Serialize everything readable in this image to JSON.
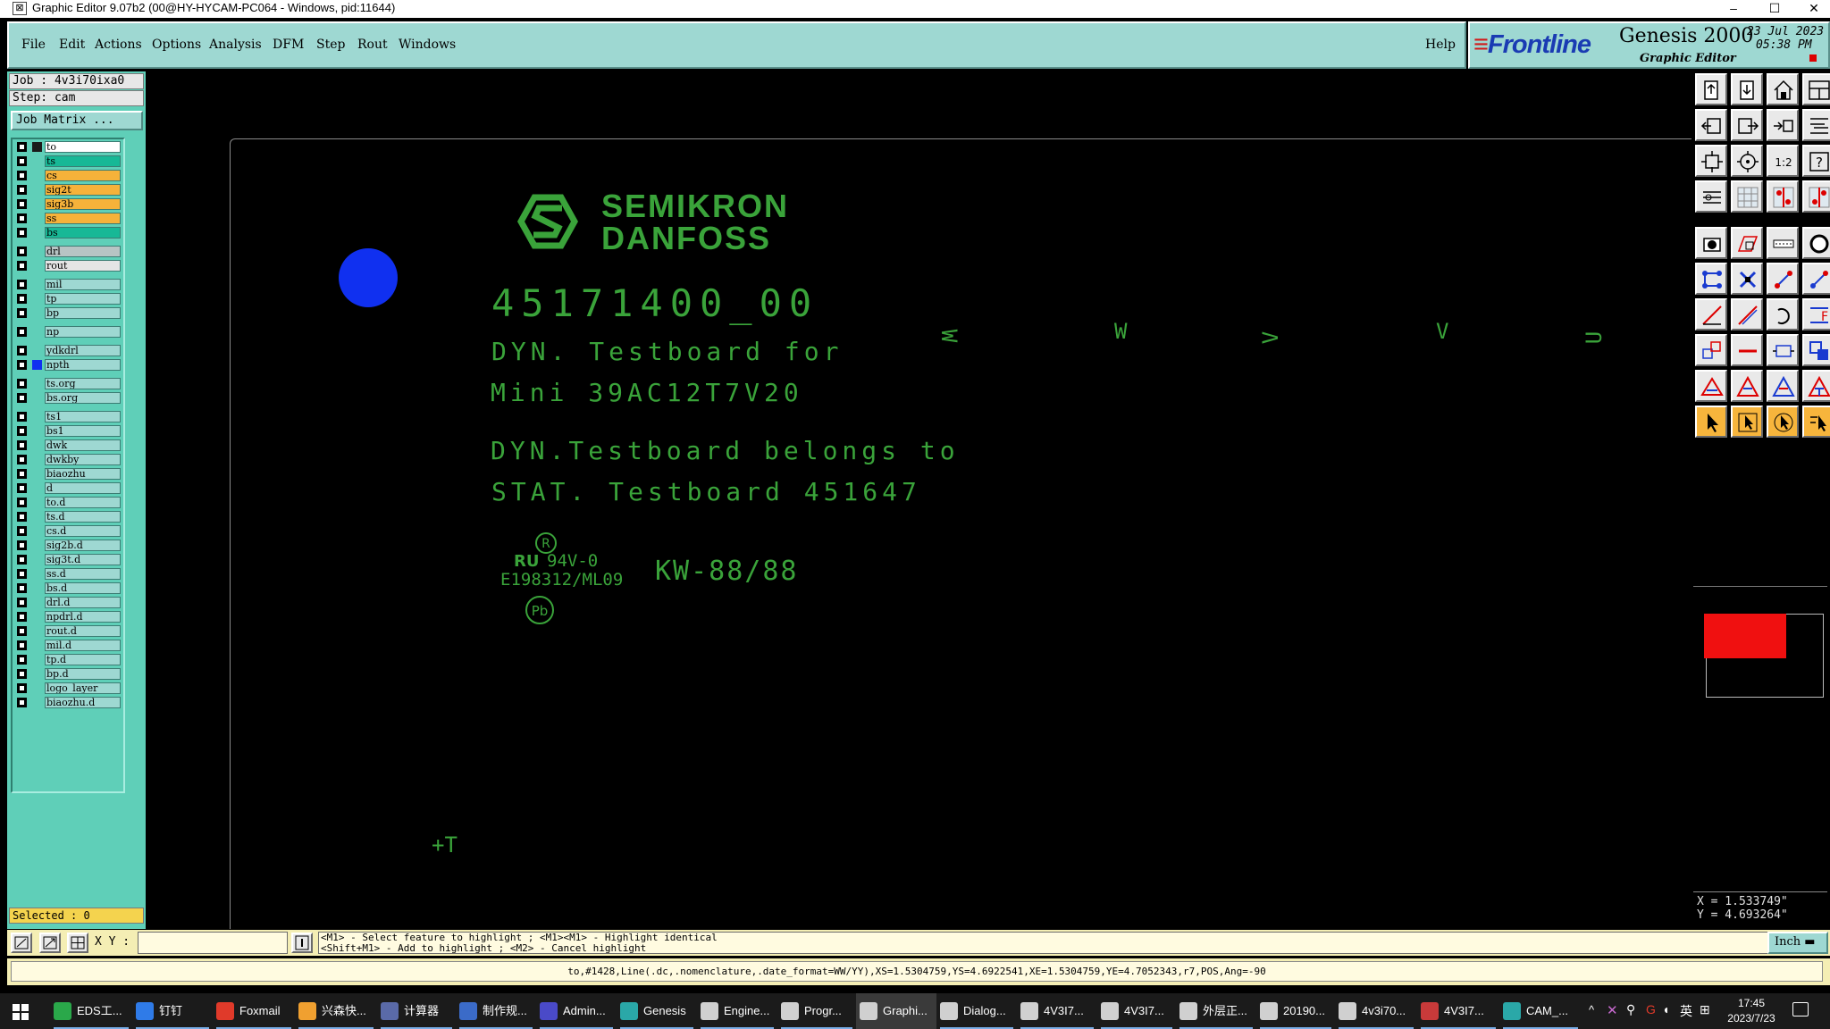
{
  "window": {
    "title": "Graphic Editor 9.07b2 (00@HY-HYCAM-PC064 - Windows, pid:11644)",
    "controls": [
      "–",
      "☐",
      "✕"
    ]
  },
  "menubar": {
    "items": [
      "File",
      "Edit",
      "Actions",
      "Options",
      "Analysis",
      "DFM",
      "Step",
      "Rout",
      "Windows"
    ],
    "help": "Help"
  },
  "brand": {
    "logo": "Frontline",
    "product": "Genesis 2000",
    "subtitle": "Graphic Editor",
    "date": "23 Jul 2023",
    "time": "05:38 PM"
  },
  "job": {
    "job_label": "Job : 4v3i70ixa0",
    "step_label": "Step: cam",
    "matrix_button": "Job Matrix ..."
  },
  "layers": [
    {
      "name": "to",
      "color": "#ffffff",
      "swatch": "#1a1a1a",
      "gap_before": false
    },
    {
      "name": "ts",
      "color": "#17b896",
      "swatch": "#5fcfb8",
      "gap_before": false
    },
    {
      "name": "cs",
      "color": "#f6b23a",
      "swatch": "#5fcfb8",
      "gap_before": false
    },
    {
      "name": "sig2t",
      "color": "#f6b23a",
      "swatch": "#5fcfb8",
      "gap_before": false
    },
    {
      "name": "sig3b",
      "color": "#f6b23a",
      "swatch": "#5fcfb8",
      "gap_before": false
    },
    {
      "name": "ss",
      "color": "#f6b23a",
      "swatch": "#5fcfb8",
      "gap_before": false
    },
    {
      "name": "bs",
      "color": "#17b896",
      "swatch": "#5fcfb8",
      "gap_before": false
    },
    {
      "name": "drl",
      "color": "#b7c4c4",
      "swatch": "#5fcfb8",
      "gap_before": true
    },
    {
      "name": "rout",
      "color": "#e5e5e5",
      "swatch": "#5fcfb8",
      "gap_before": false
    },
    {
      "name": "mil",
      "color": "#9ed8d2",
      "swatch": "#5fcfb8",
      "gap_before": true
    },
    {
      "name": "tp",
      "color": "#9ed8d2",
      "swatch": "#5fcfb8",
      "gap_before": false
    },
    {
      "name": "bp",
      "color": "#9ed8d2",
      "swatch": "#5fcfb8",
      "gap_before": false
    },
    {
      "name": "np",
      "color": "#9ed8d2",
      "swatch": "#5fcfb8",
      "gap_before": true
    },
    {
      "name": "ydkdrl",
      "color": "#9ed8d2",
      "swatch": "#5fcfb8",
      "gap_before": true
    },
    {
      "name": "npth",
      "color": "#9ed8d2",
      "swatch": "#1030f0",
      "gap_before": false
    },
    {
      "name": "ts.org",
      "color": "#9ed8d2",
      "swatch": "#5fcfb8",
      "gap_before": true
    },
    {
      "name": "bs.org",
      "color": "#9ed8d2",
      "swatch": "#5fcfb8",
      "gap_before": false
    },
    {
      "name": "ts1",
      "color": "#9ed8d2",
      "swatch": "#5fcfb8",
      "gap_before": true
    },
    {
      "name": "bs1",
      "color": "#9ed8d2",
      "swatch": "#5fcfb8",
      "gap_before": false
    },
    {
      "name": "dwk",
      "color": "#9ed8d2",
      "swatch": "#5fcfb8",
      "gap_before": false
    },
    {
      "name": "dwkby",
      "color": "#9ed8d2",
      "swatch": "#5fcfb8",
      "gap_before": false
    },
    {
      "name": "biaozhu",
      "color": "#9ed8d2",
      "swatch": "#5fcfb8",
      "gap_before": false
    },
    {
      "name": "d",
      "color": "#9ed8d2",
      "swatch": "#5fcfb8",
      "gap_before": false
    },
    {
      "name": "to.d",
      "color": "#9ed8d2",
      "swatch": "#5fcfb8",
      "gap_before": false
    },
    {
      "name": "ts.d",
      "color": "#9ed8d2",
      "swatch": "#5fcfb8",
      "gap_before": false
    },
    {
      "name": "cs.d",
      "color": "#9ed8d2",
      "swatch": "#5fcfb8",
      "gap_before": false
    },
    {
      "name": "sig2b.d",
      "color": "#9ed8d2",
      "swatch": "#5fcfb8",
      "gap_before": false
    },
    {
      "name": "sig3t.d",
      "color": "#9ed8d2",
      "swatch": "#5fcfb8",
      "gap_before": false
    },
    {
      "name": "ss.d",
      "color": "#9ed8d2",
      "swatch": "#5fcfb8",
      "gap_before": false
    },
    {
      "name": "bs.d",
      "color": "#9ed8d2",
      "swatch": "#5fcfb8",
      "gap_before": false
    },
    {
      "name": "drl.d",
      "color": "#9ed8d2",
      "swatch": "#5fcfb8",
      "gap_before": false
    },
    {
      "name": "npdrl.d",
      "color": "#9ed8d2",
      "swatch": "#5fcfb8",
      "gap_before": false
    },
    {
      "name": "rout.d",
      "color": "#9ed8d2",
      "swatch": "#5fcfb8",
      "gap_before": false
    },
    {
      "name": "mil.d",
      "color": "#9ed8d2",
      "swatch": "#5fcfb8",
      "gap_before": false
    },
    {
      "name": "tp.d",
      "color": "#9ed8d2",
      "swatch": "#5fcfb8",
      "gap_before": false
    },
    {
      "name": "bp.d",
      "color": "#9ed8d2",
      "swatch": "#5fcfb8",
      "gap_before": false
    },
    {
      "name": "logo_layer_",
      "color": "#9ed8d2",
      "swatch": "#5fcfb8",
      "gap_before": false
    },
    {
      "name": "biaozhu.d",
      "color": "#9ed8d2",
      "swatch": "#5fcfb8",
      "gap_before": false
    }
  ],
  "selected_label": "Selected : 0",
  "canvas": {
    "logo_line1": "SEMIKRON",
    "logo_line2": "DANFOSS",
    "part_number": "45171400_00",
    "line1": "DYN. Testboard for",
    "line2": "Mini 39AC12T7V20",
    "line3": "DYN.Testboard belongs to",
    "line4": "STAT. Testboard 451647",
    "ul_rating": "94V-0",
    "ul_code": "E198312/ML09",
    "kw": "KW-88/88",
    "marker": "+T",
    "rotated_labels": [
      "W",
      "W",
      "V",
      "V",
      "U"
    ]
  },
  "toolbox": {
    "icons": [
      "layer-up-icon",
      "layer-down-icon",
      "home-icon",
      "window-icon",
      "prev-icon",
      "next-icon",
      "mirror-icon",
      "step-icon",
      "fit-icon",
      "center-icon",
      "zoom-ratio-icon",
      "help-icon",
      "measure-icon",
      "grid-icon",
      "snap-red-icon",
      "snap-red2-icon",
      "pad-icon",
      "surface-icon",
      "line-icon",
      "circle-icon",
      "route-icon",
      "cross-icon",
      "point-icon",
      "node-icon",
      "edit-line-icon",
      "slash-icon",
      "arc-icon",
      "drill-icon",
      "move-icon",
      "minus-icon",
      "resize-icon",
      "copy-icon",
      "triangle-icon",
      "triangle-a-icon",
      "triangle-b-icon",
      "triangle-c-icon",
      "pointer-icon",
      "pointer-box-icon",
      "pointer-circle-icon",
      "pointer-multi-icon"
    ]
  },
  "coords": {
    "x": "X = 1.533749\"",
    "y": "Y = 4.693264\""
  },
  "cmd": {
    "xy_label": "X Y :",
    "xy_value": "",
    "hint_line1": "<M1> - Select feature to highlight ; <M1><M1> - Highlight identical",
    "hint_line2": "<Shift+M1> - Add to highlight ; <M2> - Cancel highlight",
    "units": "Inch"
  },
  "status_line": "to,#1428,Line(.dc,.nomenclature,.date_format=WW/YY),XS=1.5304759,YS=4.6922541,XE=1.5304759,YE=4.7052343,r7,POS,Ang=-90",
  "taskbar": {
    "items": [
      {
        "label": "EDS工...",
        "color": "#2aa84a",
        "state": "open"
      },
      {
        "label": "钉钉",
        "color": "#2f7be8",
        "state": "open"
      },
      {
        "label": "Foxmail",
        "color": "#e03a2a",
        "state": "open"
      },
      {
        "label": "兴森快...",
        "color": "#f0a030",
        "state": "open"
      },
      {
        "label": "计算器",
        "color": "#5a6aa8",
        "state": "open"
      },
      {
        "label": "制作规...",
        "color": "#3b6bc8",
        "state": "open"
      },
      {
        "label": "Admin...",
        "color": "#4a4ac8",
        "state": "open"
      },
      {
        "label": "Genesis",
        "color": "#2aa8a8",
        "state": "open"
      },
      {
        "label": "Engine...",
        "color": "#d0d0d0",
        "state": "open"
      },
      {
        "label": "Progr...",
        "color": "#d0d0d0",
        "state": "open"
      },
      {
        "label": "Graphi...",
        "color": "#d0d0d0",
        "state": "active"
      },
      {
        "label": "Dialog...",
        "color": "#d0d0d0",
        "state": "open"
      },
      {
        "label": "4V3I7...",
        "color": "#d0d0d0",
        "state": "open"
      },
      {
        "label": "4V3I7...",
        "color": "#d0d0d0",
        "state": "open"
      },
      {
        "label": "外层正...",
        "color": "#d0d0d0",
        "state": "open"
      },
      {
        "label": "20190...",
        "color": "#d0d0d0",
        "state": "open"
      },
      {
        "label": "4v3i70...",
        "color": "#d0d0d0",
        "state": "open"
      },
      {
        "label": "4V3I7...",
        "color": "#c83a3a",
        "state": "open"
      },
      {
        "label": "CAM_...",
        "color": "#2aa8a8",
        "state": "open"
      }
    ],
    "tray_lang": "英",
    "time": "17:45",
    "date": "2023/7/23"
  }
}
